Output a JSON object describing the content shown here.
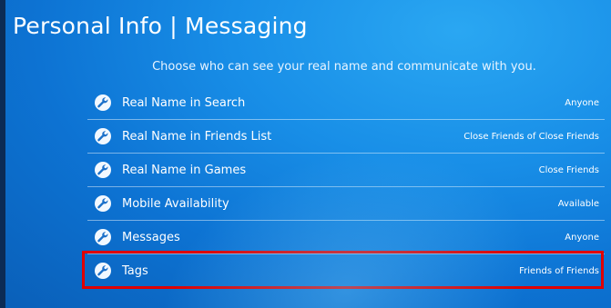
{
  "header": {
    "title": "Personal Info | Messaging"
  },
  "description": "Choose who can see your real name and communicate with you.",
  "settings": [
    {
      "label": "Real Name in Search",
      "value": "Anyone",
      "icon": "wrench-icon"
    },
    {
      "label": "Real Name in Friends List",
      "value": "Close Friends of Close Friends",
      "icon": "wrench-icon"
    },
    {
      "label": "Real Name in Games",
      "value": "Close Friends",
      "icon": "wrench-icon"
    },
    {
      "label": "Mobile Availability",
      "value": "Available",
      "icon": "wrench-icon"
    },
    {
      "label": "Messages",
      "value": "Anyone",
      "icon": "wrench-icon"
    },
    {
      "label": "Tags",
      "value": "Friends of Friends",
      "icon": "wrench-icon"
    }
  ],
  "colors": {
    "background": "#188ee7",
    "text": "#ffffff",
    "highlight_border": "#e00000"
  },
  "highlighted_item": "Tags"
}
